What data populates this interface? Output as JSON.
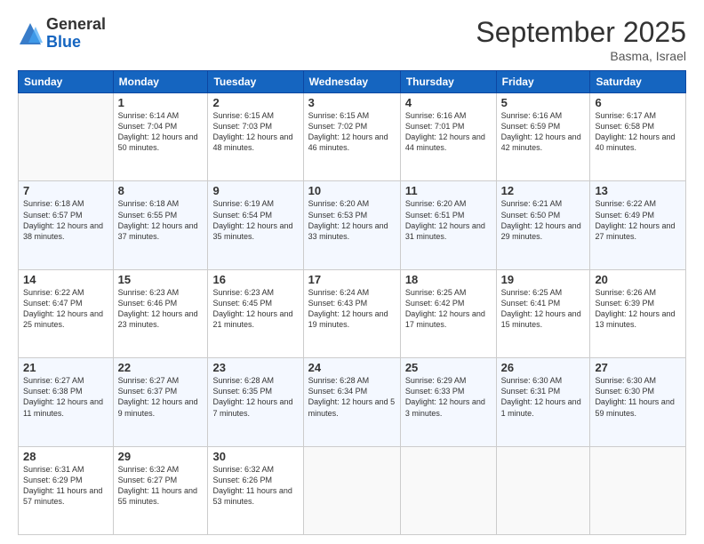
{
  "logo": {
    "general": "General",
    "blue": "Blue"
  },
  "header": {
    "month": "September 2025",
    "location": "Basma, Israel"
  },
  "days_of_week": [
    "Sunday",
    "Monday",
    "Tuesday",
    "Wednesday",
    "Thursday",
    "Friday",
    "Saturday"
  ],
  "weeks": [
    [
      {
        "day": "",
        "info": ""
      },
      {
        "day": "1",
        "info": "Sunrise: 6:14 AM\nSunset: 7:04 PM\nDaylight: 12 hours\nand 50 minutes."
      },
      {
        "day": "2",
        "info": "Sunrise: 6:15 AM\nSunset: 7:03 PM\nDaylight: 12 hours\nand 48 minutes."
      },
      {
        "day": "3",
        "info": "Sunrise: 6:15 AM\nSunset: 7:02 PM\nDaylight: 12 hours\nand 46 minutes."
      },
      {
        "day": "4",
        "info": "Sunrise: 6:16 AM\nSunset: 7:01 PM\nDaylight: 12 hours\nand 44 minutes."
      },
      {
        "day": "5",
        "info": "Sunrise: 6:16 AM\nSunset: 6:59 PM\nDaylight: 12 hours\nand 42 minutes."
      },
      {
        "day": "6",
        "info": "Sunrise: 6:17 AM\nSunset: 6:58 PM\nDaylight: 12 hours\nand 40 minutes."
      }
    ],
    [
      {
        "day": "7",
        "info": "Sunrise: 6:18 AM\nSunset: 6:57 PM\nDaylight: 12 hours\nand 38 minutes."
      },
      {
        "day": "8",
        "info": "Sunrise: 6:18 AM\nSunset: 6:55 PM\nDaylight: 12 hours\nand 37 minutes."
      },
      {
        "day": "9",
        "info": "Sunrise: 6:19 AM\nSunset: 6:54 PM\nDaylight: 12 hours\nand 35 minutes."
      },
      {
        "day": "10",
        "info": "Sunrise: 6:20 AM\nSunset: 6:53 PM\nDaylight: 12 hours\nand 33 minutes."
      },
      {
        "day": "11",
        "info": "Sunrise: 6:20 AM\nSunset: 6:51 PM\nDaylight: 12 hours\nand 31 minutes."
      },
      {
        "day": "12",
        "info": "Sunrise: 6:21 AM\nSunset: 6:50 PM\nDaylight: 12 hours\nand 29 minutes."
      },
      {
        "day": "13",
        "info": "Sunrise: 6:22 AM\nSunset: 6:49 PM\nDaylight: 12 hours\nand 27 minutes."
      }
    ],
    [
      {
        "day": "14",
        "info": "Sunrise: 6:22 AM\nSunset: 6:47 PM\nDaylight: 12 hours\nand 25 minutes."
      },
      {
        "day": "15",
        "info": "Sunrise: 6:23 AM\nSunset: 6:46 PM\nDaylight: 12 hours\nand 23 minutes."
      },
      {
        "day": "16",
        "info": "Sunrise: 6:23 AM\nSunset: 6:45 PM\nDaylight: 12 hours\nand 21 minutes."
      },
      {
        "day": "17",
        "info": "Sunrise: 6:24 AM\nSunset: 6:43 PM\nDaylight: 12 hours\nand 19 minutes."
      },
      {
        "day": "18",
        "info": "Sunrise: 6:25 AM\nSunset: 6:42 PM\nDaylight: 12 hours\nand 17 minutes."
      },
      {
        "day": "19",
        "info": "Sunrise: 6:25 AM\nSunset: 6:41 PM\nDaylight: 12 hours\nand 15 minutes."
      },
      {
        "day": "20",
        "info": "Sunrise: 6:26 AM\nSunset: 6:39 PM\nDaylight: 12 hours\nand 13 minutes."
      }
    ],
    [
      {
        "day": "21",
        "info": "Sunrise: 6:27 AM\nSunset: 6:38 PM\nDaylight: 12 hours\nand 11 minutes."
      },
      {
        "day": "22",
        "info": "Sunrise: 6:27 AM\nSunset: 6:37 PM\nDaylight: 12 hours\nand 9 minutes."
      },
      {
        "day": "23",
        "info": "Sunrise: 6:28 AM\nSunset: 6:35 PM\nDaylight: 12 hours\nand 7 minutes."
      },
      {
        "day": "24",
        "info": "Sunrise: 6:28 AM\nSunset: 6:34 PM\nDaylight: 12 hours\nand 5 minutes."
      },
      {
        "day": "25",
        "info": "Sunrise: 6:29 AM\nSunset: 6:33 PM\nDaylight: 12 hours\nand 3 minutes."
      },
      {
        "day": "26",
        "info": "Sunrise: 6:30 AM\nSunset: 6:31 PM\nDaylight: 12 hours\nand 1 minute."
      },
      {
        "day": "27",
        "info": "Sunrise: 6:30 AM\nSunset: 6:30 PM\nDaylight: 11 hours\nand 59 minutes."
      }
    ],
    [
      {
        "day": "28",
        "info": "Sunrise: 6:31 AM\nSunset: 6:29 PM\nDaylight: 11 hours\nand 57 minutes."
      },
      {
        "day": "29",
        "info": "Sunrise: 6:32 AM\nSunset: 6:27 PM\nDaylight: 11 hours\nand 55 minutes."
      },
      {
        "day": "30",
        "info": "Sunrise: 6:32 AM\nSunset: 6:26 PM\nDaylight: 11 hours\nand 53 minutes."
      },
      {
        "day": "",
        "info": ""
      },
      {
        "day": "",
        "info": ""
      },
      {
        "day": "",
        "info": ""
      },
      {
        "day": "",
        "info": ""
      }
    ]
  ]
}
